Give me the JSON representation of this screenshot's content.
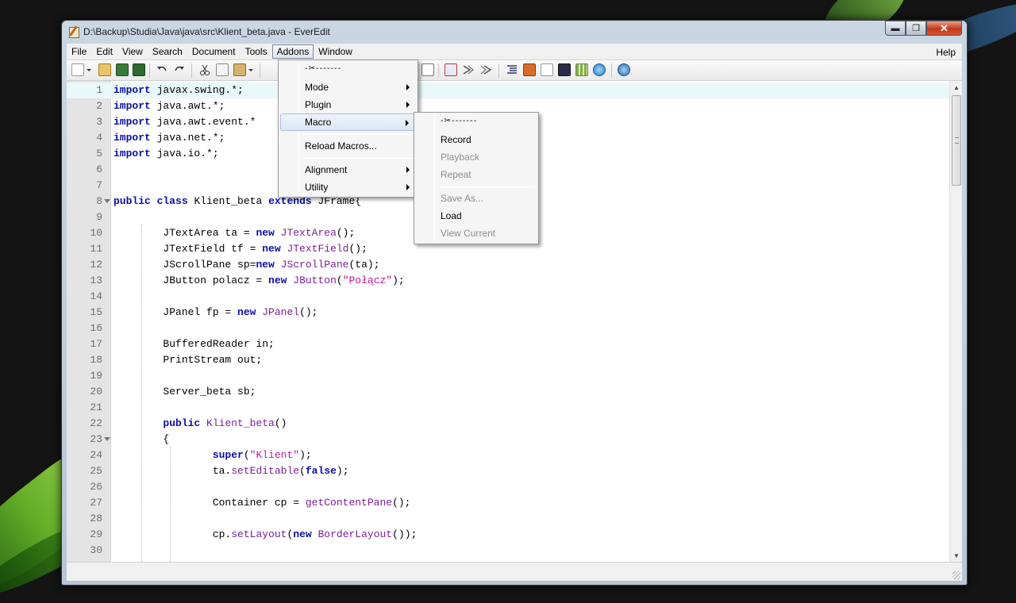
{
  "window": {
    "title": "D:\\Backup\\Studia\\Java\\java\\src\\Klient_beta.java - EverEdit",
    "minimize_glyph": "▬",
    "maximize_glyph": "❐",
    "close_glyph": "✕"
  },
  "menubar": {
    "items": [
      "File",
      "Edit",
      "View",
      "Search",
      "Document",
      "Tools",
      "Addons",
      "Window"
    ],
    "help": "Help",
    "active": "Addons"
  },
  "addons_menu": {
    "tearoff": "-✂-------",
    "items": [
      {
        "label": "Mode",
        "submenu": true
      },
      {
        "label": "Plugin",
        "submenu": true
      },
      {
        "label": "Macro",
        "submenu": true,
        "highlighted": true
      },
      {
        "label": "Reload Macros...",
        "submenu": false
      },
      {
        "label": "Alignment",
        "submenu": true
      },
      {
        "label": "Utility",
        "submenu": true
      }
    ]
  },
  "macro_menu": {
    "tearoff": "-✂-------",
    "items": [
      {
        "label": "Record",
        "enabled": true
      },
      {
        "label": "Playback",
        "enabled": false
      },
      {
        "label": "Repeat",
        "enabled": false
      },
      {
        "label": "Save As...",
        "enabled": false
      },
      {
        "label": "Load",
        "enabled": true
      },
      {
        "label": "View Current",
        "enabled": false
      }
    ]
  },
  "editor": {
    "current_line": 1,
    "lines": [
      "import javax.swing.*;",
      "import java.awt.*;",
      "import java.awt.event.*",
      "import java.net.*;",
      "import java.io.*;",
      "",
      "",
      "public class Klient_beta extends JFrame{",
      "",
      "        JTextArea ta = new JTextArea();",
      "        JTextField tf = new JTextField();",
      "        JScrollPane sp=new JScrollPane(ta);",
      "        JButton polacz = new JButton(\"Połącz\");",
      "",
      "        JPanel fp = new JPanel();",
      "",
      "        BufferedReader in;",
      "        PrintStream out;",
      "",
      "        Server_beta sb;",
      "",
      "        public Klient_beta()",
      "        {",
      "                super(\"Klient\");",
      "                ta.setEditable(false);",
      "",
      "                Container cp = getContentPane();",
      "",
      "                cp.setLayout(new BorderLayout());",
      ""
    ],
    "line_numbers": [
      "1",
      "2",
      "3",
      "4",
      "5",
      "6",
      "7",
      "8",
      "9",
      "10",
      "11",
      "12",
      "13",
      "14",
      "15",
      "16",
      "17",
      "18",
      "19",
      "20",
      "21",
      "22",
      "23",
      "24",
      "25",
      "26",
      "27",
      "28",
      "29",
      "30"
    ],
    "folds": [
      8,
      23
    ]
  },
  "toolbar": {
    "icons": [
      "new-file-icon",
      "dropdown-arrow-icon",
      "open-folder-icon",
      "save-icon",
      "save-all-icon",
      "undo-icon",
      "redo-icon",
      "cut-icon",
      "copy-icon",
      "paste-icon",
      "paste-dropdown-icon",
      "hex-icon",
      "wrap-icon",
      "indent-icon",
      "outdent-icon",
      "list-icon",
      "image-icon",
      "window-icon",
      "monitor-icon",
      "grid-icon",
      "browser-icon",
      "help-icon"
    ]
  },
  "statusbar": {
    "text": ""
  },
  "colors": {
    "keyword": "#0b0fa8",
    "method": "#7a1f9a",
    "string": "#c2189c",
    "current_line": "#e8f8fb"
  }
}
